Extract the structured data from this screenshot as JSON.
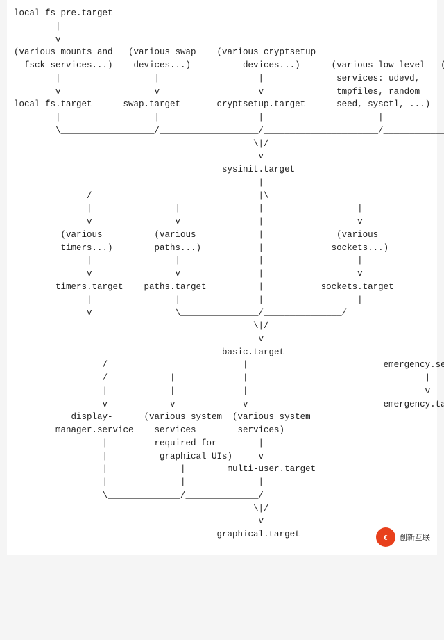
{
  "diagram": {
    "content": "local-fs-pre.target\n        |\n        v\n(various mounts and   (various swap    (various cryptsetup\n  fsck services...)    devices...)          devices...)      (various low-level   (various low-level\n        |                  |                   |              services: udevd,     API VFS mounts:\n        v                  v                   v              tmpfiles, random     mqueue, configfs,\nlocal-fs.target      swap.target       cryptsetup.target      seed, sysctl, ...)   debugfs, ...)\n        |                  |                   |                      |                    |\n        \\__________________/___________________/______________________/____________________/\n                                              \\|/\n                                               v\n                                        sysinit.target\n                                               |\n              /________________________________|\\___________________________________________\\\n              |                |               |                  |                         |\n              v                v               |                  v                         v\n         (various          (various            |              (various             rescue.service\n         timers...)        paths...)           |             sockets...)                    |\n              |                |               |                  |                         v\n              v                v               |                  v                rescue.target\n        timers.target    paths.target          |           sockets.target\n              |                |               |                  |\n              v                \\_______________/_______________/\n                                              \\|/\n                                               v\n                                        basic.target\n                 /__________________________|                                emergency.service\n                 /            |             |                                        |\n                 |            |             |                                        v\n                 v            v             v                                emergency.target\n           display-      (various system  (various system\n        manager.service    services        services)\n                 |         required for        |\n                 |          graphical UIs)     v\n                 |              |        multi-user.target\n                 |              |              |\n                 \\______________/______________/\n                                              \\|/\n                                               v\n                                       graphical.target"
  },
  "watermark": {
    "text": "创新互联",
    "logo_char": "€"
  }
}
